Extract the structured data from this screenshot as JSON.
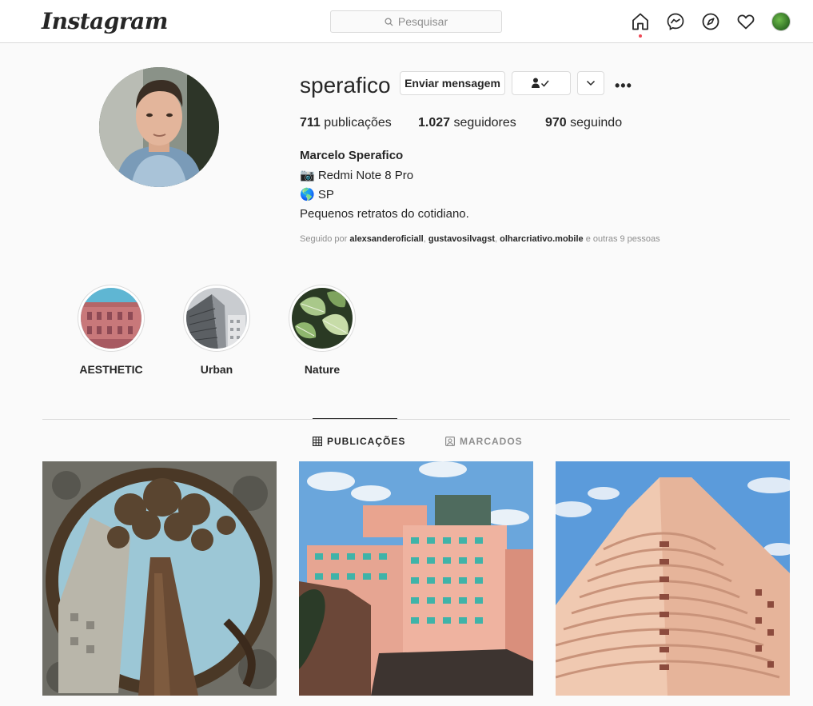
{
  "nav": {
    "logo": "Instagram",
    "search_placeholder": "Pesquisar",
    "icons": [
      "home-icon",
      "messenger-icon",
      "explore-icon",
      "heart-icon",
      "avatar"
    ]
  },
  "profile": {
    "username": "sperafico",
    "message_button": "Enviar mensagem",
    "stats": {
      "posts_count": "711",
      "posts_label": " publicações",
      "followers_count": "1.027",
      "followers_label": " seguidores",
      "following_count": "970",
      "following_label": " seguindo"
    },
    "full_name": "Marcelo Sperafico",
    "bio_lines": [
      "📷 Redmi Note 8 Pro",
      "🌎 SP",
      "Pequenos retratos do cotidiano."
    ],
    "followed_by": {
      "prefix": "Seguido por ",
      "users": [
        "alexsanderoficiall",
        "gustavosilvagst",
        "olharcriativo.mobile"
      ],
      "suffix": " e outras 9 pessoas"
    }
  },
  "highlights": [
    {
      "label": "AESTHETIC"
    },
    {
      "label": "Urban"
    },
    {
      "label": "Nature"
    }
  ],
  "tabs": {
    "posts": "PUBLICAÇÕES",
    "tagged": "MARCADOS"
  },
  "colors": {
    "accent_dot": "#ed4956",
    "text": "#262626",
    "muted": "#8e8e8e",
    "border": "#dbdbdb"
  }
}
